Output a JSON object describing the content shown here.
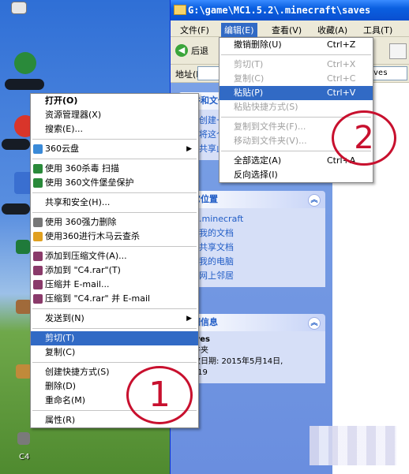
{
  "window": {
    "title": "G:\\game\\MC1.5.2\\.minecraft\\saves",
    "menubar": {
      "items": [
        "文件(F)",
        "编辑(E)",
        "查看(V)",
        "收藏(A)",
        "工具(T)"
      ],
      "active_index": 1
    },
    "toolbar": {
      "back_label": "后退"
    },
    "address": {
      "label": "地址(D)",
      "value_visible": "ves"
    }
  },
  "taskpane": {
    "file_tasks": {
      "title": "文件和文件夹任务",
      "items": [
        "创建一个新文件夹",
        "将这个文件夹发布到 Web",
        "共享此文件夹"
      ]
    },
    "other_places": {
      "title": "其它位置",
      "items": [
        ".minecraft",
        "我的文档",
        "共享文档",
        "我的电脑",
        "网上邻居"
      ]
    },
    "details": {
      "title": "详细信息",
      "name": "saves",
      "type": "文件夹",
      "modified": "修改日期: 2015年5月14日,",
      "time": "11:19"
    }
  },
  "context_menu": {
    "items": [
      {
        "label": "打开(O)",
        "bold": true
      },
      {
        "label": "资源管理器(X)"
      },
      {
        "label": "搜索(E)..."
      },
      {
        "sep": true
      },
      {
        "label": "360云盘",
        "submenu": true,
        "icon": "cloud-icon"
      },
      {
        "sep": true
      },
      {
        "label": "使用 360杀毒 扫描",
        "icon": "shield-icon"
      },
      {
        "label": "使用 360文件堡垒保护",
        "icon": "shield-icon"
      },
      {
        "sep": true
      },
      {
        "label": "共享和安全(H)..."
      },
      {
        "sep": true
      },
      {
        "label": "使用 360强力删除",
        "icon": "shredder-icon"
      },
      {
        "label": "使用360进行木马云查杀",
        "icon": "trojan-scan-icon"
      },
      {
        "sep": true
      },
      {
        "label": "添加到压缩文件(A)...",
        "icon": "archive-icon"
      },
      {
        "label": "添加到 \"C4.rar\"(T)",
        "icon": "archive-icon"
      },
      {
        "label": "压缩并 E-mail...",
        "icon": "archive-icon"
      },
      {
        "label": "压缩到 \"C4.rar\" 并 E-mail",
        "icon": "archive-icon"
      },
      {
        "sep": true
      },
      {
        "label": "发送到(N)",
        "submenu": true
      },
      {
        "sep": true
      },
      {
        "label": "剪切(T)",
        "highlight": true
      },
      {
        "label": "复制(C)"
      },
      {
        "sep": true
      },
      {
        "label": "创建快捷方式(S)"
      },
      {
        "label": "删除(D)"
      },
      {
        "label": "重命名(M)"
      },
      {
        "sep": true
      },
      {
        "label": "属性(R)"
      }
    ]
  },
  "edit_menu": {
    "items": [
      {
        "label": "撤销删除(U)",
        "shortcut": "Ctrl+Z"
      },
      {
        "sep": true
      },
      {
        "label": "剪切(T)",
        "shortcut": "Ctrl+X",
        "disabled": true
      },
      {
        "label": "复制(C)",
        "shortcut": "Ctrl+C",
        "disabled": true
      },
      {
        "label": "粘贴(P)",
        "shortcut": "Ctrl+V",
        "highlight": true
      },
      {
        "label": "粘贴快捷方式(S)",
        "disabled": true
      },
      {
        "sep": true
      },
      {
        "label": "复制到文件夹(F)...",
        "disabled": true
      },
      {
        "label": "移动到文件夹(V)...",
        "disabled": true
      },
      {
        "sep": true
      },
      {
        "label": "全部选定(A)",
        "shortcut": "Ctrl+A"
      },
      {
        "label": "反向选择(I)"
      }
    ]
  },
  "annotations": {
    "step1": "1",
    "step2": "2"
  },
  "desktop": {
    "icon_label": "C4"
  },
  "colors": {
    "highlight": "#316ac5",
    "title_bar": "#0a5fe0",
    "annotation": "#c8102e"
  }
}
